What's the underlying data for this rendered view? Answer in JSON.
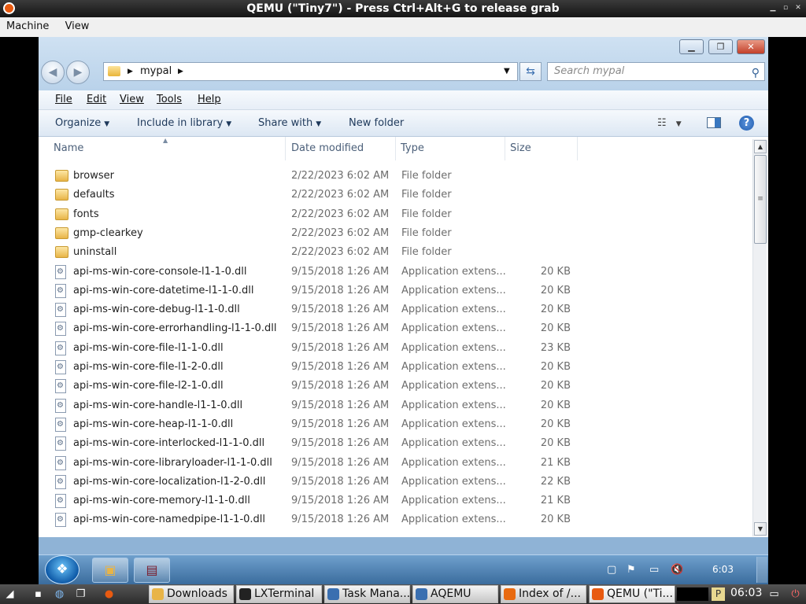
{
  "qemu": {
    "title": "QEMU (\"Tiny7\") - Press Ctrl+Alt+G to release grab",
    "menu": [
      "Machine",
      "View"
    ]
  },
  "explorer": {
    "breadcrumb": [
      "mypal"
    ],
    "search_placeholder": "Search mypal",
    "menu": [
      "File",
      "Edit",
      "View",
      "Tools",
      "Help"
    ],
    "toolbar": {
      "organize": "Organize",
      "include_in_library": "Include in library",
      "share_with": "Share with",
      "new_folder": "New folder"
    },
    "columns": {
      "name": "Name",
      "date": "Date modified",
      "type": "Type",
      "size": "Size"
    },
    "files": [
      {
        "name": "browser",
        "date": "2/22/2023 6:02 AM",
        "type": "File folder",
        "size": "",
        "kind": "folder"
      },
      {
        "name": "defaults",
        "date": "2/22/2023 6:02 AM",
        "type": "File folder",
        "size": "",
        "kind": "folder"
      },
      {
        "name": "fonts",
        "date": "2/22/2023 6:02 AM",
        "type": "File folder",
        "size": "",
        "kind": "folder"
      },
      {
        "name": "gmp-clearkey",
        "date": "2/22/2023 6:02 AM",
        "type": "File folder",
        "size": "",
        "kind": "folder"
      },
      {
        "name": "uninstall",
        "date": "2/22/2023 6:02 AM",
        "type": "File folder",
        "size": "",
        "kind": "folder"
      },
      {
        "name": "api-ms-win-core-console-l1-1-0.dll",
        "date": "9/15/2018 1:26 AM",
        "type": "Application extens...",
        "size": "20 KB",
        "kind": "dll"
      },
      {
        "name": "api-ms-win-core-datetime-l1-1-0.dll",
        "date": "9/15/2018 1:26 AM",
        "type": "Application extens...",
        "size": "20 KB",
        "kind": "dll"
      },
      {
        "name": "api-ms-win-core-debug-l1-1-0.dll",
        "date": "9/15/2018 1:26 AM",
        "type": "Application extens...",
        "size": "20 KB",
        "kind": "dll"
      },
      {
        "name": "api-ms-win-core-errorhandling-l1-1-0.dll",
        "date": "9/15/2018 1:26 AM",
        "type": "Application extens...",
        "size": "20 KB",
        "kind": "dll"
      },
      {
        "name": "api-ms-win-core-file-l1-1-0.dll",
        "date": "9/15/2018 1:26 AM",
        "type": "Application extens...",
        "size": "23 KB",
        "kind": "dll"
      },
      {
        "name": "api-ms-win-core-file-l1-2-0.dll",
        "date": "9/15/2018 1:26 AM",
        "type": "Application extens...",
        "size": "20 KB",
        "kind": "dll"
      },
      {
        "name": "api-ms-win-core-file-l2-1-0.dll",
        "date": "9/15/2018 1:26 AM",
        "type": "Application extens...",
        "size": "20 KB",
        "kind": "dll"
      },
      {
        "name": "api-ms-win-core-handle-l1-1-0.dll",
        "date": "9/15/2018 1:26 AM",
        "type": "Application extens...",
        "size": "20 KB",
        "kind": "dll"
      },
      {
        "name": "api-ms-win-core-heap-l1-1-0.dll",
        "date": "9/15/2018 1:26 AM",
        "type": "Application extens...",
        "size": "20 KB",
        "kind": "dll"
      },
      {
        "name": "api-ms-win-core-interlocked-l1-1-0.dll",
        "date": "9/15/2018 1:26 AM",
        "type": "Application extens...",
        "size": "20 KB",
        "kind": "dll"
      },
      {
        "name": "api-ms-win-core-libraryloader-l1-1-0.dll",
        "date": "9/15/2018 1:26 AM",
        "type": "Application extens...",
        "size": "21 KB",
        "kind": "dll"
      },
      {
        "name": "api-ms-win-core-localization-l1-2-0.dll",
        "date": "9/15/2018 1:26 AM",
        "type": "Application extens...",
        "size": "22 KB",
        "kind": "dll"
      },
      {
        "name": "api-ms-win-core-memory-l1-1-0.dll",
        "date": "9/15/2018 1:26 AM",
        "type": "Application extens...",
        "size": "21 KB",
        "kind": "dll"
      },
      {
        "name": "api-ms-win-core-namedpipe-l1-1-0.dll",
        "date": "9/15/2018 1:26 AM",
        "type": "Application extens...",
        "size": "20 KB",
        "kind": "dll"
      }
    ]
  },
  "win7_taskbar": {
    "clock": "6:03"
  },
  "host_panel": {
    "tasks": [
      {
        "label": "Downloads",
        "color": "#e8b447"
      },
      {
        "label": "LXTerminal",
        "color": "#222222"
      },
      {
        "label": "Task Mana...",
        "color": "#3a6fb0"
      },
      {
        "label": "AQEMU",
        "color": "#3a6fb0"
      },
      {
        "label": "Index of /...",
        "color": "#e86a10"
      },
      {
        "label": "QEMU (\"Ti...",
        "color": "#e85a10"
      }
    ],
    "clock": "06:03"
  },
  "icons": {
    "qemu_logo": "qemu-logo-icon",
    "back": "back-arrow-icon",
    "forward": "forward-arrow-icon",
    "folder": "folder-icon",
    "dll": "dll-file-icon",
    "search": "search-icon",
    "refresh": "refresh-icon",
    "help": "help-icon",
    "view": "view-options-icon",
    "preview": "preview-pane-icon"
  }
}
